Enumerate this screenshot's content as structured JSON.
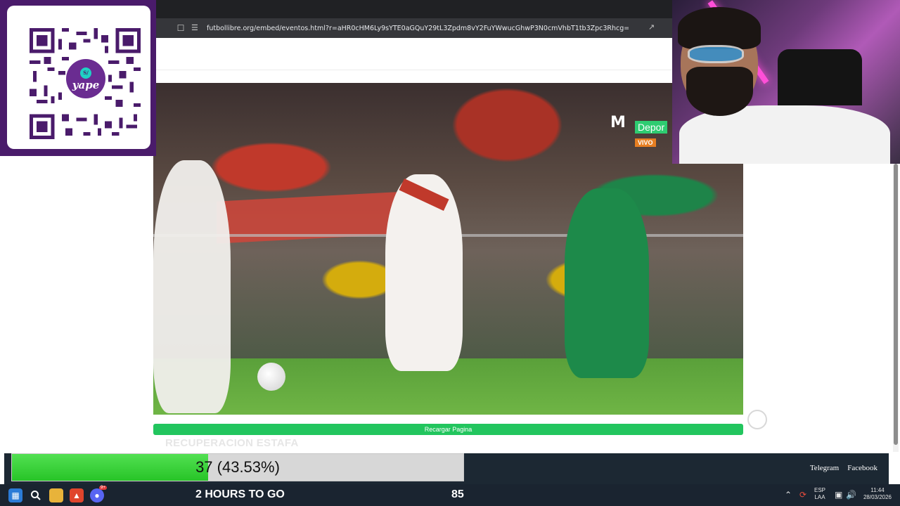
{
  "browser": {
    "url": "futbollibre.org/embed/eventos.html?r=aHR0cHM6Ly9sYTE0aGQuY29tL3Zpdm8vY2FuYWwucGhwP3N0cmVhbT1tb3Zpc3Rhcg=="
  },
  "qr_overlay": {
    "brand": "yape",
    "coin": "S/"
  },
  "video": {
    "broadcaster_logo": "M",
    "channel_tag": "Depor",
    "live_tag": "VIVO"
  },
  "page": {
    "reload_button": "Recargar Pagina",
    "faded_heading": "RECUPERACION ESTAFA"
  },
  "footer": {
    "links": [
      "Telegram",
      "Facebook"
    ]
  },
  "goal_widget": {
    "label": "37 (43.53%)",
    "fill_fraction": 0.4353,
    "countdown": "2 HOURS TO GO",
    "target": "85",
    "fill_color": "#27c427"
  },
  "taskbar": {
    "language_top": "ESP",
    "language_bottom": "LAA",
    "time": "11:44",
    "date": "28/03/2026",
    "notification_count": "9+"
  }
}
